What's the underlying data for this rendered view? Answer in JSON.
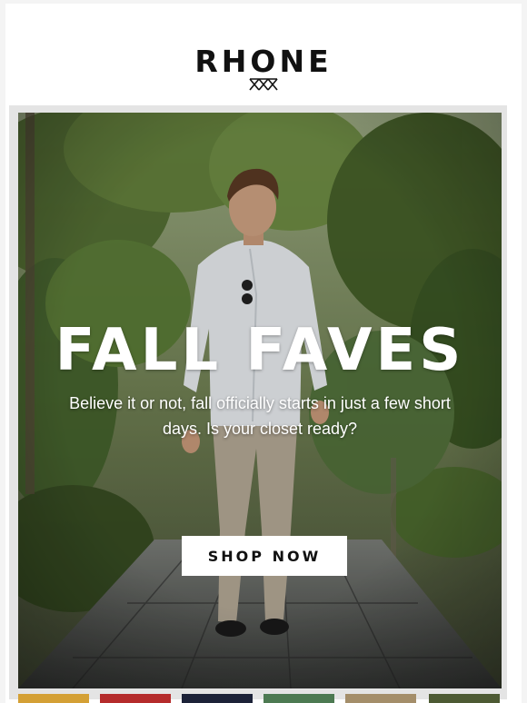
{
  "header": {
    "brand": "RHONE",
    "logo_mark_icon": "triple-cross-icon"
  },
  "hero": {
    "title": "FALL FAVES",
    "subtitle": "Believe it or not, fall officially starts in just a few short days. Is your closet ready?",
    "cta_label": "SHOP NOW"
  },
  "swatches": [
    {
      "name": "mustard",
      "color": "#d4a035"
    },
    {
      "name": "red",
      "color": "#b52b2b"
    },
    {
      "name": "navy",
      "color": "#1c2238"
    },
    {
      "name": "green",
      "color": "#4d7a52"
    },
    {
      "name": "khaki",
      "color": "#a48e6a"
    },
    {
      "name": "olive",
      "color": "#4d5a33"
    }
  ],
  "colors": {
    "background": "#f4f4f4",
    "frame": "#e4e4e4",
    "text_dark": "#111111",
    "button_bg": "#ffffff"
  }
}
